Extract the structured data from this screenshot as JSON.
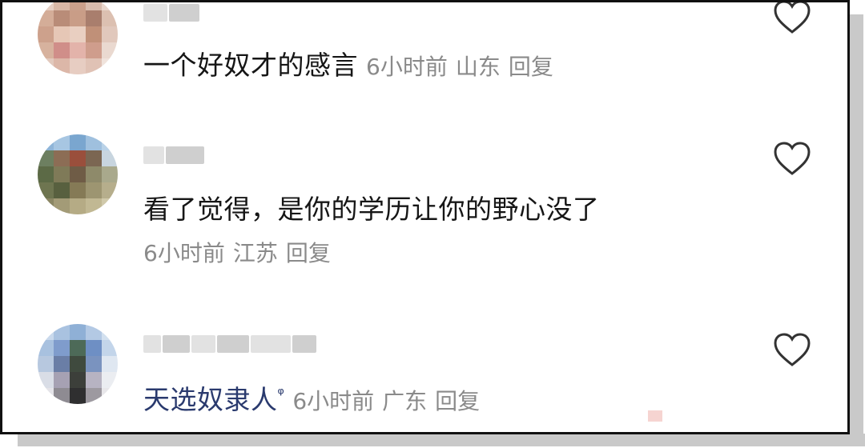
{
  "comments": [
    {
      "text": "一个好奴才的感言",
      "time": "6小时前",
      "location": "山东",
      "reply": "回复"
    },
    {
      "text": "看了觉得，是你的学历让你的野心没了",
      "time": "6小时前",
      "location": "江苏",
      "reply": "回复"
    },
    {
      "text": "天选奴隶人",
      "search_mark": "ᵠ",
      "time": "6小时前",
      "location": "广东",
      "reply": "回复"
    }
  ],
  "colors": {
    "primary_text": "#161616",
    "meta_text": "#8a8a8a",
    "link_text": "#2a3a6e",
    "border": "#111111"
  },
  "icons": [
    "heart-icon",
    "search-icon"
  ]
}
